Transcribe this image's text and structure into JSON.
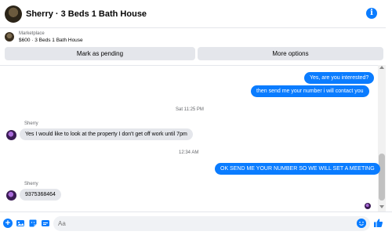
{
  "header": {
    "title": "Sherry · 3 Beds 1 Bath House"
  },
  "marketplace": {
    "label": "Marketplace",
    "listing": "$600 · 3 Beds 1 Bath House",
    "pending_label": "Mark as pending",
    "more_label": "More options"
  },
  "messages": [
    {
      "text": "Yes, are you interested?",
      "direction": "outgoing"
    },
    {
      "text": "then send me your number i will contact you",
      "direction": "outgoing"
    },
    {
      "timestamp": "Sat 11:25 PM"
    },
    {
      "sender": "Sherry",
      "text": "Yes I would like to look at the property I don't get off work until 7pm",
      "direction": "incoming"
    },
    {
      "timestamp": "12:34 AM"
    },
    {
      "text": "OK SEND ME YOUR NUMBER SO WE WILL SET A MEETING",
      "direction": "outgoing"
    },
    {
      "sender": "Sherry",
      "text": "9375368464",
      "direction": "incoming"
    }
  ],
  "composer": {
    "placeholder": "Aa"
  },
  "icons": {
    "info": "info-icon",
    "add": "plus-icon",
    "photo": "photo-icon",
    "sticker": "sticker-icon",
    "gif": "gif-icon",
    "emoji": "emoji-icon",
    "like": "thumbs-up-icon"
  },
  "colors": {
    "accent": "#0a7cff",
    "incoming_bubble": "#e4e6eb",
    "secondary_text": "#65676b"
  }
}
